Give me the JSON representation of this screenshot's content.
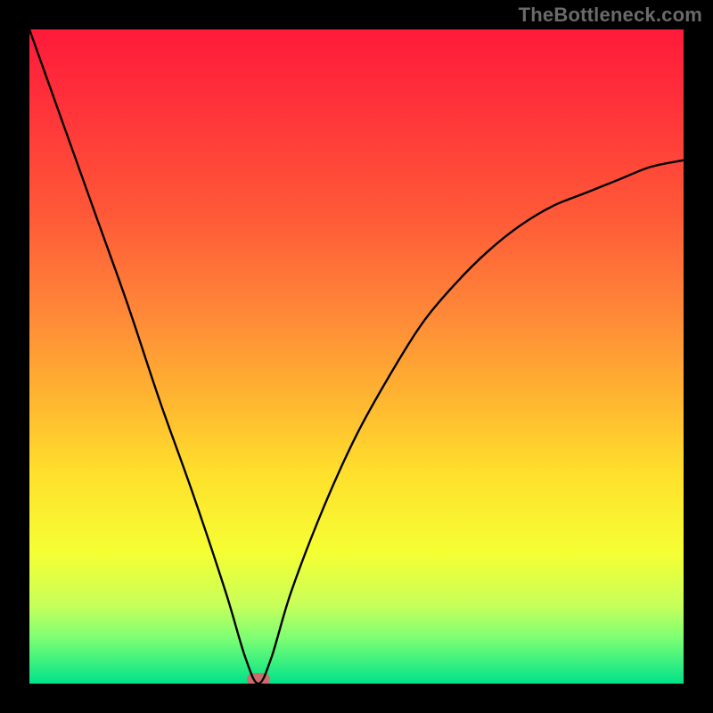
{
  "watermark": "TheBottleneck.com",
  "chart_data": {
    "type": "line",
    "title": "",
    "xlabel": "",
    "ylabel": "",
    "xlim": [
      0,
      100
    ],
    "ylim": [
      0,
      100
    ],
    "background_gradient_meaning": "red (top) = high bottleneck %, green (bottom) = 0% bottleneck",
    "gradient_stops": [
      {
        "pos": 0.0,
        "color": "#ff1a3a"
      },
      {
        "pos": 0.08,
        "color": "#ff2a3a"
      },
      {
        "pos": 0.28,
        "color": "#ff5838"
      },
      {
        "pos": 0.44,
        "color": "#ff8a38"
      },
      {
        "pos": 0.56,
        "color": "#ffb431"
      },
      {
        "pos": 0.68,
        "color": "#ffe02c"
      },
      {
        "pos": 0.8,
        "color": "#f5ff33"
      },
      {
        "pos": 0.88,
        "color": "#c8ff5a"
      },
      {
        "pos": 0.93,
        "color": "#7dff73"
      },
      {
        "pos": 1.0,
        "color": "#00e28a"
      }
    ],
    "ideal_x": 35,
    "series": [
      {
        "name": "bottleneck-curve",
        "x": [
          0,
          5,
          10,
          15,
          20,
          25,
          30,
          33,
          35,
          37,
          40,
          45,
          50,
          55,
          60,
          65,
          70,
          75,
          80,
          85,
          90,
          95,
          100
        ],
        "values": [
          100,
          86,
          72,
          58,
          43,
          29,
          14,
          4,
          0,
          4,
          14,
          27,
          38,
          47,
          55,
          61,
          66,
          70,
          73,
          75,
          77,
          79,
          80
        ]
      }
    ],
    "ideal_marker": {
      "x": 35,
      "y": 0,
      "width_frac": 0.035,
      "height_frac": 0.02
    }
  }
}
